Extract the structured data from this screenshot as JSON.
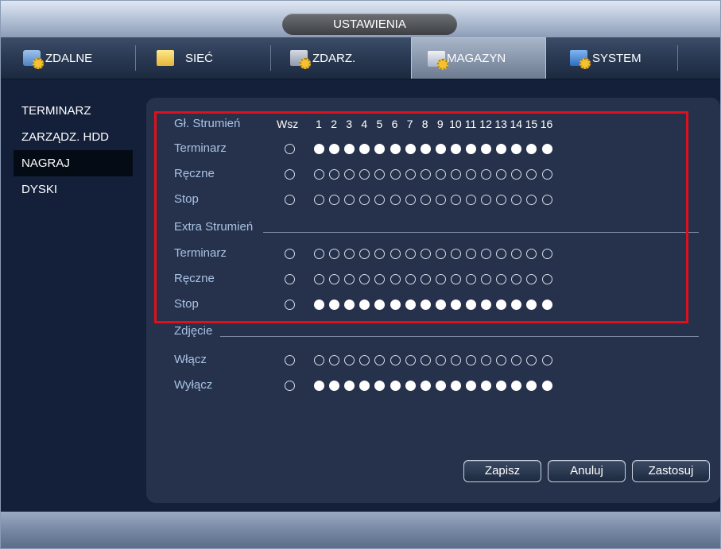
{
  "window": {
    "title": "USTAWIENIA"
  },
  "tabs": [
    {
      "label": "ZDALNE",
      "icon": "remote-camera-icon",
      "active": false
    },
    {
      "label": "SIEĆ",
      "icon": "network-icon",
      "active": false
    },
    {
      "label": "ZDARZ.",
      "icon": "event-icon",
      "active": false
    },
    {
      "label": "MAGAZYN",
      "icon": "storage-icon",
      "active": true
    },
    {
      "label": "SYSTEM",
      "icon": "system-icon",
      "active": false
    }
  ],
  "sidebar": {
    "items": [
      {
        "label": "TERMINARZ",
        "active": false
      },
      {
        "label": "ZARZĄDZ. HDD",
        "active": false
      },
      {
        "label": "NAGRAJ",
        "active": true
      },
      {
        "label": "DYSKI",
        "active": false
      }
    ]
  },
  "record": {
    "header_label": "Gł. Strumień",
    "all_label": "Wsz",
    "channels": [
      "1",
      "2",
      "3",
      "4",
      "5",
      "6",
      "7",
      "8",
      "9",
      "10",
      "11",
      "12",
      "13",
      "14",
      "15",
      "16"
    ],
    "main_stream": [
      {
        "label": "Terminarz",
        "all": false,
        "values": [
          true,
          true,
          true,
          true,
          true,
          true,
          true,
          true,
          true,
          true,
          true,
          true,
          true,
          true,
          true,
          true
        ]
      },
      {
        "label": "Ręczne",
        "all": false,
        "values": [
          false,
          false,
          false,
          false,
          false,
          false,
          false,
          false,
          false,
          false,
          false,
          false,
          false,
          false,
          false,
          false
        ]
      },
      {
        "label": "Stop",
        "all": false,
        "values": [
          false,
          false,
          false,
          false,
          false,
          false,
          false,
          false,
          false,
          false,
          false,
          false,
          false,
          false,
          false,
          false
        ]
      }
    ],
    "extra_label": "Extra Strumień",
    "extra_stream": [
      {
        "label": "Terminarz",
        "all": false,
        "values": [
          false,
          false,
          false,
          false,
          false,
          false,
          false,
          false,
          false,
          false,
          false,
          false,
          false,
          false,
          false,
          false
        ]
      },
      {
        "label": "Ręczne",
        "all": false,
        "values": [
          false,
          false,
          false,
          false,
          false,
          false,
          false,
          false,
          false,
          false,
          false,
          false,
          false,
          false,
          false,
          false
        ]
      },
      {
        "label": "Stop",
        "all": false,
        "values": [
          true,
          true,
          true,
          true,
          true,
          true,
          true,
          true,
          true,
          true,
          true,
          true,
          true,
          true,
          true,
          true
        ]
      }
    ],
    "snapshot_label": "Zdjęcie",
    "snapshot": [
      {
        "label": "Włącz",
        "all": false,
        "values": [
          false,
          false,
          false,
          false,
          false,
          false,
          false,
          false,
          false,
          false,
          false,
          false,
          false,
          false,
          false,
          false
        ]
      },
      {
        "label": "Wyłącz",
        "all": false,
        "values": [
          true,
          true,
          true,
          true,
          true,
          true,
          true,
          true,
          true,
          true,
          true,
          true,
          true,
          true,
          true,
          true
        ]
      }
    ]
  },
  "buttons": {
    "save": "Zapisz",
    "cancel": "Anuluj",
    "apply": "Zastosuj"
  },
  "colors": {
    "highlight": "#e0101a",
    "label": "#a8c2e4",
    "panel": "#26324b"
  }
}
